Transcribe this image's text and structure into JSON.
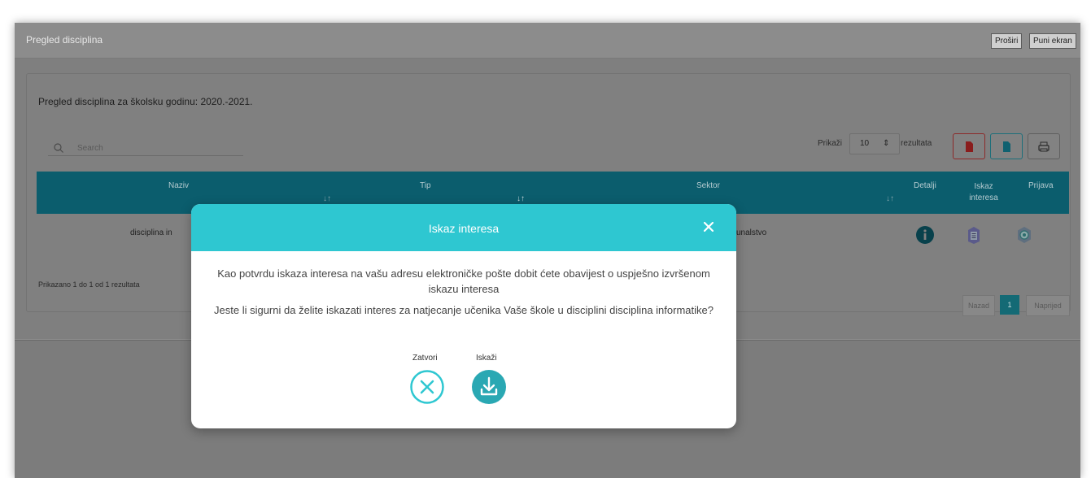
{
  "panel": {
    "title": "Pregled disciplina",
    "expand_label": "Proširi",
    "fullscreen_label": "Puni ekran"
  },
  "card": {
    "title": "Pregled disciplina za školsku godinu: 2020.-2021."
  },
  "search": {
    "placeholder": "Search"
  },
  "page_size": {
    "prefix": "Prikaži",
    "value": "10",
    "suffix": "rezultata"
  },
  "toolbar": {
    "pdf_icon": "pdf-file-icon",
    "excel_icon": "excel-file-icon",
    "print_icon": "print-icon"
  },
  "table": {
    "columns": [
      "Naziv",
      "Tip",
      "Sektor",
      "Detalji",
      "Iskaz interesa",
      "Prijava"
    ],
    "rows": [
      {
        "naziv": "disciplina in",
        "sektor": "unalstvo"
      }
    ]
  },
  "footer": {
    "info": "Prikazano 1 do 1 od 1 rezultata",
    "prev": "Nazad",
    "page": "1",
    "next": "Naprijed"
  },
  "modal": {
    "title": "Iskaz interesa",
    "line1": "Kao potvrdu iskaza interesa na vašu adresu elektroničke pošte dobit ćete obavijest o uspješno izvršenom iskazu interesa",
    "line2": "Jeste li sigurni da želite iskazati interes za natjecanje učenika Vaše škole u disciplini disciplina informatike?",
    "close_label": "Zatvori",
    "confirm_label": "Iskaži"
  },
  "colors": {
    "modal_header": "#2ec7d1",
    "table_header": "#0b5d6d",
    "accent": "#2aa8b3"
  }
}
